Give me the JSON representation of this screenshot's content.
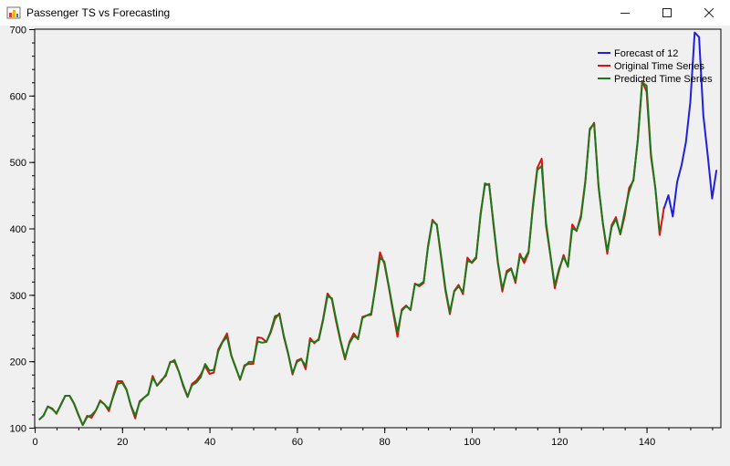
{
  "window": {
    "title": "Passenger TS vs Forecasting",
    "icons": {
      "app": "chart-app-icon",
      "minimize": "minimize-icon",
      "maximize": "maximize-icon",
      "close": "close-icon"
    }
  },
  "chart_data": {
    "type": "line",
    "title": "",
    "xlabel": "",
    "ylabel": "",
    "xlim": [
      0,
      157
    ],
    "ylim": [
      100,
      700
    ],
    "x_ticks": [
      "0",
      "20",
      "40",
      "60",
      "80",
      "100",
      "120",
      "140"
    ],
    "y_ticks": [
      "100",
      "200",
      "300",
      "400",
      "500",
      "600",
      "700"
    ],
    "grid": false,
    "legend_position": "top-right",
    "series": [
      {
        "name": "Forecast of 12",
        "color": "#1f1fe0",
        "x_start": 144,
        "values": [
          430,
          450,
          418,
          470,
          495,
          530,
          590,
          695,
          688,
          570,
          510,
          445,
          488
        ]
      },
      {
        "name": "Original Time Series",
        "color": "#e01010",
        "x_start": 1,
        "values": [
          112,
          118,
          132,
          129,
          121,
          135,
          148,
          148,
          136,
          119,
          104,
          118,
          115,
          126,
          141,
          135,
          125,
          149,
          170,
          170,
          158,
          133,
          114,
          140,
          145,
          150,
          178,
          163,
          172,
          178,
          199,
          199,
          184,
          162,
          146,
          166,
          171,
          180,
          193,
          181,
          183,
          218,
          230,
          242,
          209,
          191,
          172,
          194,
          196,
          196,
          236,
          235,
          229,
          243,
          264,
          272,
          237,
          211,
          180,
          201,
          204,
          188,
          235,
          227,
          234,
          264,
          302,
          293,
          259,
          229,
          203,
          229,
          242,
          233,
          267,
          269,
          270,
          315,
          364,
          347,
          312,
          274,
          237,
          278,
          284,
          277,
          317,
          313,
          318,
          374,
          413,
          405,
          355,
          306,
          271,
          306,
          315,
          301,
          356,
          348,
          355,
          422,
          465,
          467,
          404,
          347,
          305,
          336,
          340,
          318,
          362,
          348,
          363,
          435,
          491,
          505,
          404,
          359,
          310,
          337,
          360,
          342,
          406,
          396,
          420,
          472,
          548,
          559,
          463,
          407,
          362,
          405,
          417,
          391,
          419,
          461,
          472,
          535,
          622,
          606,
          508,
          461,
          390,
          432
        ]
      },
      {
        "name": "Predicted Time Series",
        "color": "#1a7a1a",
        "x_start": 1,
        "values": [
          112,
          118,
          132,
          128,
          122,
          134,
          148,
          148,
          137,
          120,
          104,
          116,
          119,
          126,
          140,
          135,
          128,
          147,
          166,
          168,
          157,
          134,
          118,
          138,
          145,
          151,
          175,
          164,
          170,
          180,
          198,
          202,
          184,
          164,
          147,
          164,
          168,
          176,
          196,
          186,
          187,
          215,
          229,
          237,
          208,
          190,
          173,
          192,
          199,
          199,
          230,
          228,
          229,
          245,
          268,
          270,
          239,
          212,
          182,
          199,
          203,
          193,
          231,
          229,
          232,
          262,
          298,
          295,
          262,
          231,
          205,
          227,
          238,
          234,
          265,
          269,
          272,
          312,
          356,
          350,
          314,
          277,
          244,
          276,
          283,
          278,
          316,
          315,
          320,
          372,
          411,
          406,
          358,
          309,
          274,
          305,
          313,
          304,
          351,
          349,
          357,
          419,
          468,
          465,
          407,
          349,
          309,
          333,
          339,
          321,
          358,
          353,
          365,
          431,
          488,
          494,
          409,
          360,
          314,
          340,
          357,
          343,
          400,
          397,
          416,
          470,
          550,
          558,
          465,
          408,
          366,
          402,
          414,
          392,
          425,
          455,
          474,
          533,
          620,
          615,
          512,
          460,
          395
        ]
      }
    ]
  }
}
